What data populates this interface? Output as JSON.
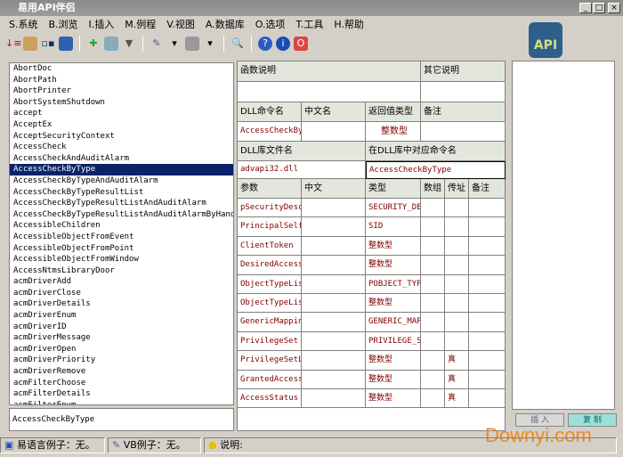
{
  "window": {
    "title": "易用API伴侣"
  },
  "menu": [
    "S.系统",
    "B.浏览",
    "I.插入",
    "M.例程",
    "V.视图",
    "A.数据库",
    "O.选项",
    "T.工具",
    "H.帮助"
  ],
  "list": {
    "items": [
      "AbortDoc",
      "AbortPath",
      "AbortPrinter",
      "AbortSystemShutdown",
      "accept",
      "AcceptEx",
      "AcceptSecurityContext",
      "AccessCheck",
      "AccessCheckAndAuditAlarm",
      "AccessCheckByType",
      "AccessCheckByTypeAndAuditAlarm",
      "AccessCheckByTypeResultList",
      "AccessCheckByTypeResultListAndAuditAlarm",
      "AccessCheckByTypeResultListAndAuditAlarmByHandle",
      "AccessibleChildren",
      "AccessibleObjectFromEvent",
      "AccessibleObjectFromPoint",
      "AccessibleObjectFromWindow",
      "AccessNtmsLibraryDoor",
      "acmDriverAdd",
      "acmDriverClose",
      "acmDriverDetails",
      "acmDriverEnum",
      "acmDriverID",
      "acmDriverMessage",
      "acmDriverOpen",
      "acmDriverPriority",
      "acmDriverRemove",
      "acmFilterChoose",
      "acmFilterDetails",
      "acmFilterEnum"
    ],
    "selected": "AccessCheckByType",
    "filter": "AccessCheckByType"
  },
  "detail": {
    "func_desc_label": "函数说明",
    "other_desc_label": "其它说明",
    "dll_cmd_label": "DLL命令名",
    "cn_name_label": "中文名",
    "return_type_label": "返回值类型",
    "note_label": "备注",
    "dll_cmd": "AccessCheckByType",
    "return_type": "整数型",
    "dll_file_label": "DLL库文件名",
    "dll_entry_label": "在DLL库中对应命令名",
    "dll_file": "advapi32.dll",
    "dll_entry": "AccessCheckByType",
    "param_headers": [
      "参数",
      "中文",
      "类型",
      "数组",
      "传址",
      "备注"
    ],
    "params": [
      {
        "name": "pSecurityDescriptor",
        "type": "SECURITY_DESCRIPTOR",
        "byref": ""
      },
      {
        "name": "PrincipalSelfSid",
        "type": "SID",
        "byref": ""
      },
      {
        "name": "ClientToken",
        "type": "整数型",
        "byref": ""
      },
      {
        "name": "DesiredAccess",
        "type": "整数型",
        "byref": ""
      },
      {
        "name": "ObjectTypeList",
        "type": "POBJECT_TYPE_LIST",
        "byref": ""
      },
      {
        "name": "ObjectTypeListLength",
        "type": "整数型",
        "byref": ""
      },
      {
        "name": "GenericMapping",
        "type": "GENERIC_MAPPING",
        "byref": ""
      },
      {
        "name": "PrivilegeSet",
        "type": "PRIVILEGE_SET",
        "byref": ""
      },
      {
        "name": "PrivilegeSetLength",
        "type": "整数型",
        "byref": "真"
      },
      {
        "name": "GrantedAccess",
        "type": "整数型",
        "byref": "真"
      },
      {
        "name": "AccessStatus",
        "type": "整数型",
        "byref": "真"
      }
    ]
  },
  "right": {
    "insert_label": "插 入",
    "copy_label": "复 制",
    "logo": "API"
  },
  "status": {
    "e_example": "易语言例子：无。",
    "vb_example": "VB例子：无。",
    "desc": "说明:"
  },
  "watermark": "Downyi.com"
}
